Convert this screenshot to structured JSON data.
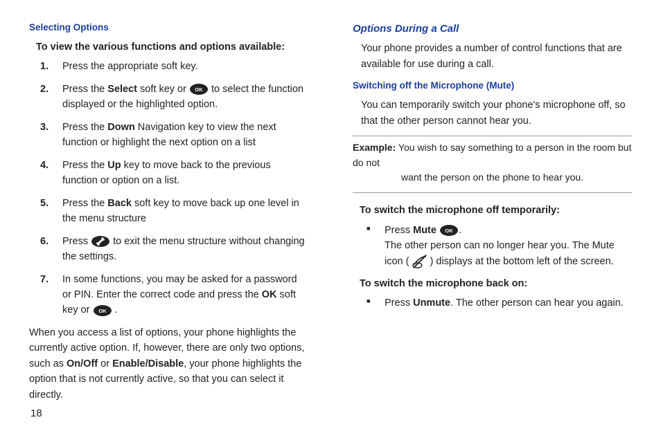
{
  "left": {
    "heading": "Selecting Options",
    "lead": "To view the various functions and options available:",
    "steps": [
      {
        "pre": "Press the appropriate soft key."
      },
      {
        "pre": "Press the ",
        "b1": "Select",
        "mid": " soft key or ",
        "icon": "ok",
        "post": " to select the function displayed or the highlighted option."
      },
      {
        "pre": "Press the ",
        "b1": "Down",
        "post": " Navigation key to view the next function or highlight the next option on a list"
      },
      {
        "pre": "Press the ",
        "b1": "Up",
        "post": " key to move back to the previous function or option on a list."
      },
      {
        "pre": "Press the ",
        "b1": "Back",
        "post": " soft key to move back up one level in the menu structure"
      },
      {
        "pre": "Press ",
        "icon": "end",
        "post": " to exit the menu structure without changing the settings."
      },
      {
        "pre": "In some functions, you may be asked for a password or PIN. Enter the correct code and press the ",
        "b1": "OK",
        "mid": " soft key or ",
        "icon": "ok",
        "post": " ."
      }
    ],
    "follow_pre": "When you access a list of options, your phone highlights the currently active option. If, however, there are only two options, such as ",
    "follow_b1": "On/Off",
    "follow_mid": " or ",
    "follow_b2": "Enable/Disable",
    "follow_post": ", your phone highlights the option that is not currently active, so that you can select it directly."
  },
  "right": {
    "heading1": "Options During a Call",
    "intro": "Your phone provides a number of control functions that are available for use during a call.",
    "heading2": "Switching off the Microphone (Mute)",
    "p2": "You can temporarily switch your phone's microphone off, so that the other person cannot hear you.",
    "example_label": "Example:",
    "example_line1": "You wish to say something to a person in the room but do not",
    "example_line2": "want the person on the phone to hear you.",
    "lead3": "To switch the microphone off temporarily:",
    "bullet1_pre": "Press ",
    "bullet1_b": "Mute",
    "bullet1_mid": " ",
    "bullet1_post": ".",
    "bullet1_l2a": "The other person can no longer hear you. The Mute icon ( ",
    "bullet1_l2b": " ) displays at the bottom left of the screen.",
    "lead4": "To switch the microphone back on:",
    "bullet2_pre": "Press ",
    "bullet2_b": "Unmute",
    "bullet2_post": ". The other person can hear you again."
  },
  "page_number": "18"
}
